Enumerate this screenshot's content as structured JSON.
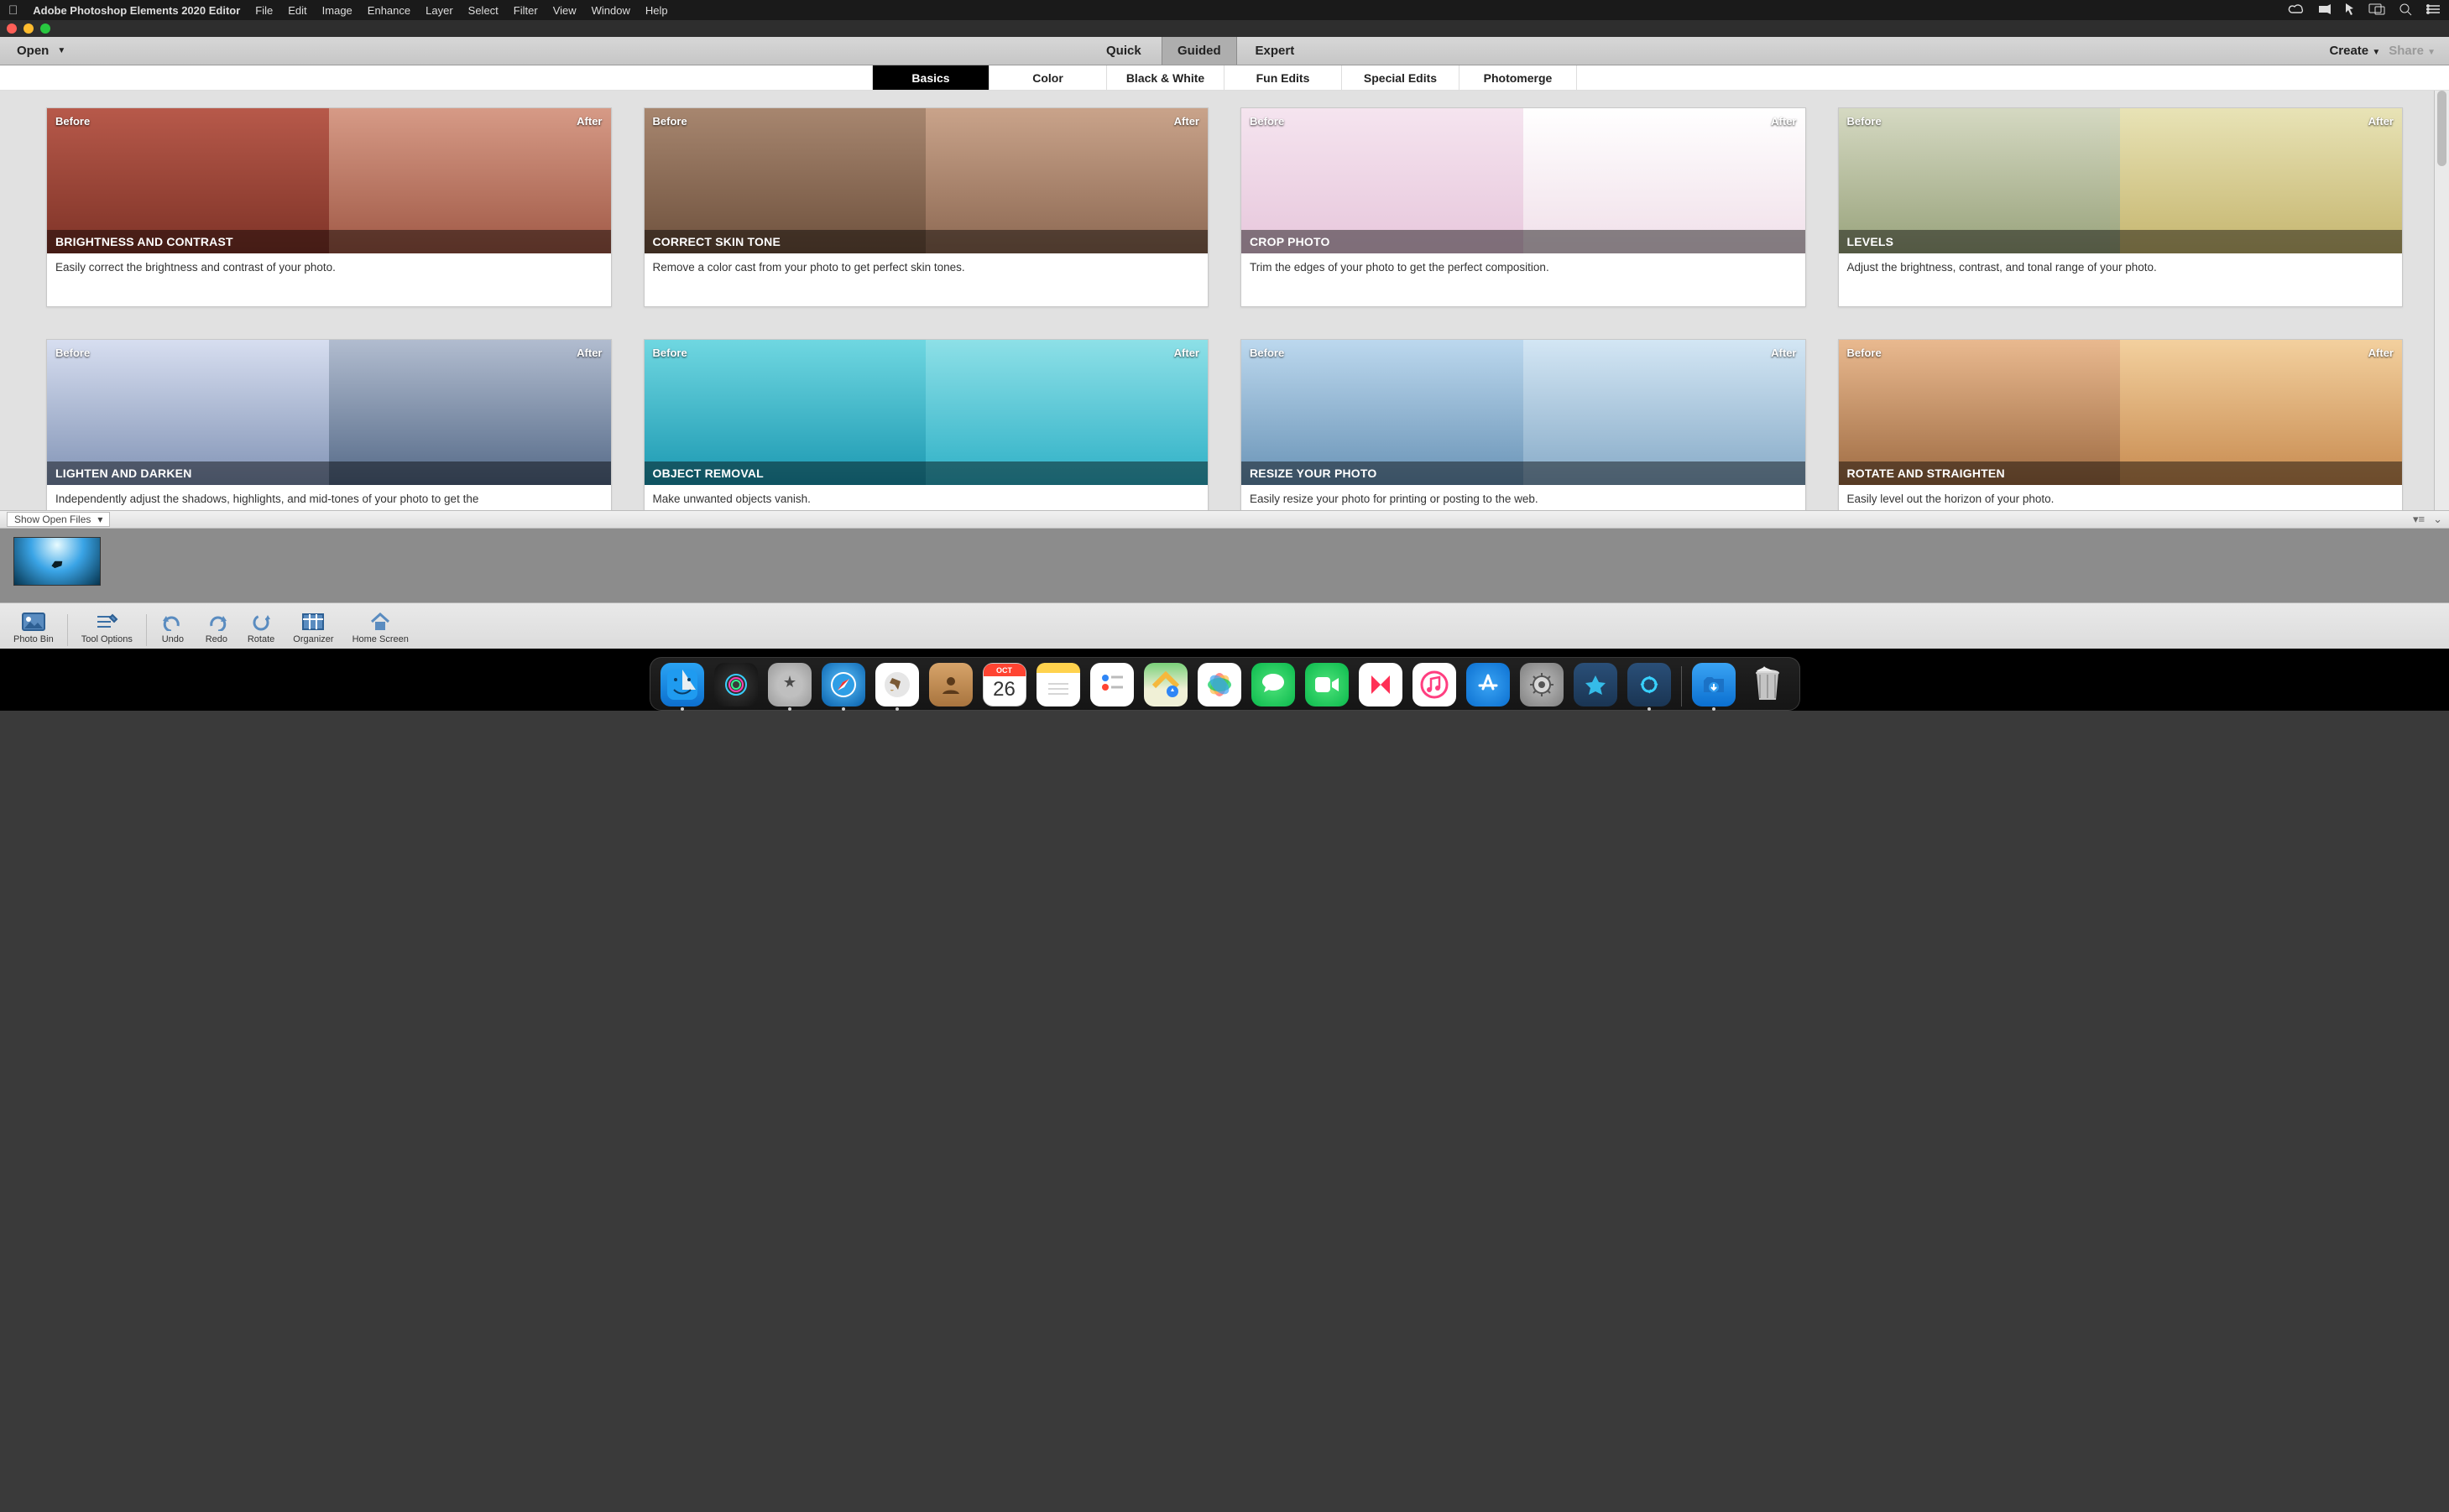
{
  "menubar": {
    "app_title": "Adobe Photoshop Elements 2020 Editor",
    "items": [
      "File",
      "Edit",
      "Image",
      "Enhance",
      "Layer",
      "Select",
      "Filter",
      "View",
      "Window",
      "Help"
    ]
  },
  "modebar": {
    "open_label": "Open",
    "modes": [
      "Quick",
      "Guided",
      "Expert"
    ],
    "active_mode": "Guided",
    "create_label": "Create",
    "share_label": "Share"
  },
  "categories": {
    "items": [
      "Basics",
      "Color",
      "Black & White",
      "Fun Edits",
      "Special Edits",
      "Photomerge"
    ],
    "active": "Basics"
  },
  "labels": {
    "before": "Before",
    "after": "After"
  },
  "cards": [
    {
      "title": "BRIGHTNESS AND CONTRAST",
      "desc": "Easily correct the brightness and contrast of your photo."
    },
    {
      "title": "CORRECT SKIN TONE",
      "desc": "Remove a color cast from your photo to get perfect skin tones."
    },
    {
      "title": "CROP PHOTO",
      "desc": "Trim the edges of your photo to get the perfect composition."
    },
    {
      "title": "LEVELS",
      "desc": "Adjust the brightness, contrast, and tonal range of your photo."
    },
    {
      "title": "LIGHTEN AND DARKEN",
      "desc": "Independently adjust the shadows, highlights, and mid-tones of your photo to get the"
    },
    {
      "title": "OBJECT REMOVAL",
      "desc": "Make unwanted objects vanish."
    },
    {
      "title": "RESIZE YOUR PHOTO",
      "desc": "Easily resize your photo for printing or posting to the web."
    },
    {
      "title": "ROTATE AND STRAIGHTEN",
      "desc": "Easily level out the horizon of your photo."
    }
  ],
  "card_bg": [
    [
      "linear-gradient(#b7594a,#7e3327)",
      "linear-gradient(#d69a86,#a05946)"
    ],
    [
      "linear-gradient(#a7866f,#6e513d)",
      "linear-gradient(#c9a38a,#8c6852)"
    ],
    [
      "linear-gradient(#f5e4ef,#e7c7dc)",
      "linear-gradient(#fff,#f0dfe9)"
    ],
    [
      "linear-gradient(#d5d9c2,#98a27b)",
      "linear-gradient(#e8e3b6,#c5b56e)"
    ],
    [
      "linear-gradient(#d7def0,#8193b5)",
      "linear-gradient(#b1bccf,#556a88)"
    ],
    [
      "linear-gradient(#6fd7e1,#1b98b1)",
      "linear-gradient(#8de0e7,#2eb0c6)"
    ],
    [
      "linear-gradient(#bcd8ee,#6993b6)",
      "linear-gradient(#d3e6f4,#86aac7)"
    ],
    [
      "linear-gradient(#e9b98f,#9e6b42)",
      "linear-gradient(#f3d09e,#c78a4f)"
    ]
  ],
  "binheader": {
    "selector": "Show Open Files"
  },
  "bottom": {
    "items": [
      "Photo Bin",
      "Tool Options",
      "Undo",
      "Redo",
      "Rotate",
      "Organizer",
      "Home Screen"
    ]
  },
  "dock": {
    "date_month": "OCT",
    "date_day": "26",
    "items_running": [
      0,
      2,
      3,
      4,
      18,
      19
    ]
  }
}
